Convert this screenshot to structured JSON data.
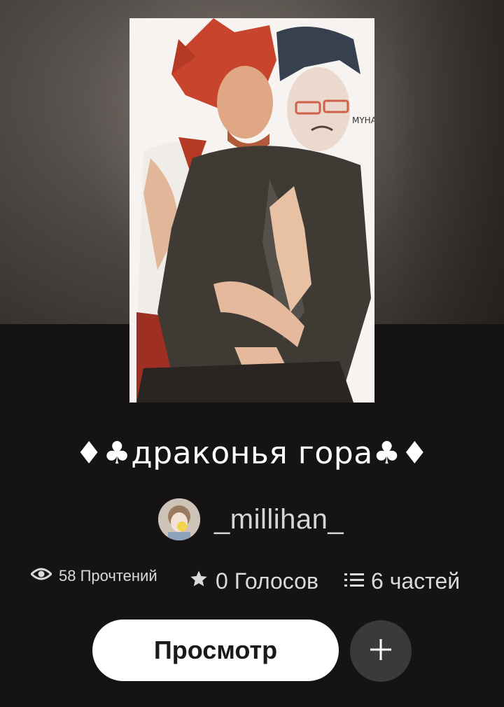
{
  "story": {
    "title": "♦♣драконья гора♣♦",
    "author": "_millihan_"
  },
  "stats": {
    "reads": "58 Прочтений",
    "votes": "0 Голосов",
    "parts": "6 частей"
  },
  "actions": {
    "view_label": "Просмотр"
  },
  "cover": {
    "signature_text": "MYHA"
  },
  "icons": {
    "reads": "eye-icon",
    "votes": "star-icon",
    "parts": "list-icon",
    "add": "plus-icon"
  },
  "colors": {
    "background": "#151314",
    "button": "#ffffff",
    "add_button": "#3b3a3b"
  }
}
